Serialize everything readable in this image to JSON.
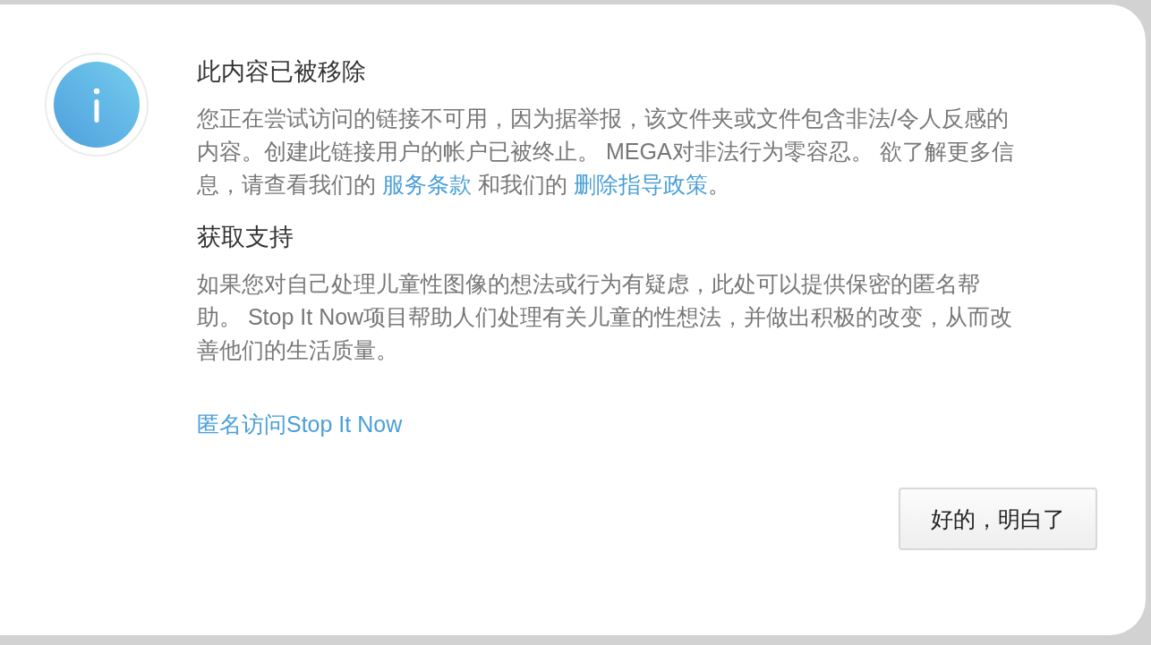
{
  "title": "此内容已被移除",
  "message": [
    {
      "kind": "text",
      "text": "您正在尝试访问的链接不可用，因为据举报，该文件夹或文件包含非法/令人反感的内容。创建此链接用户的帐户已被终止。 MEGA对非法行为零容忍。 欲了解更多信息，请查看我们的 "
    },
    {
      "kind": "link",
      "text": "服务条款"
    },
    {
      "kind": "text",
      "text": " 和我们的 "
    },
    {
      "kind": "link",
      "text": "删除指导政策"
    },
    {
      "kind": "text",
      "text": "。"
    }
  ],
  "support_heading": "获取支持",
  "support_text": "如果您对自己处理儿童性图像的想法或行为有疑虑，此处可以提供保密的匿名帮助。 Stop It Now项目帮助人们处理有关儿童的性想法，并做出积极的改变，从而改善他们的生活质量。",
  "support_link": "匿名访问Stop It Now",
  "button": "好的，明白了"
}
